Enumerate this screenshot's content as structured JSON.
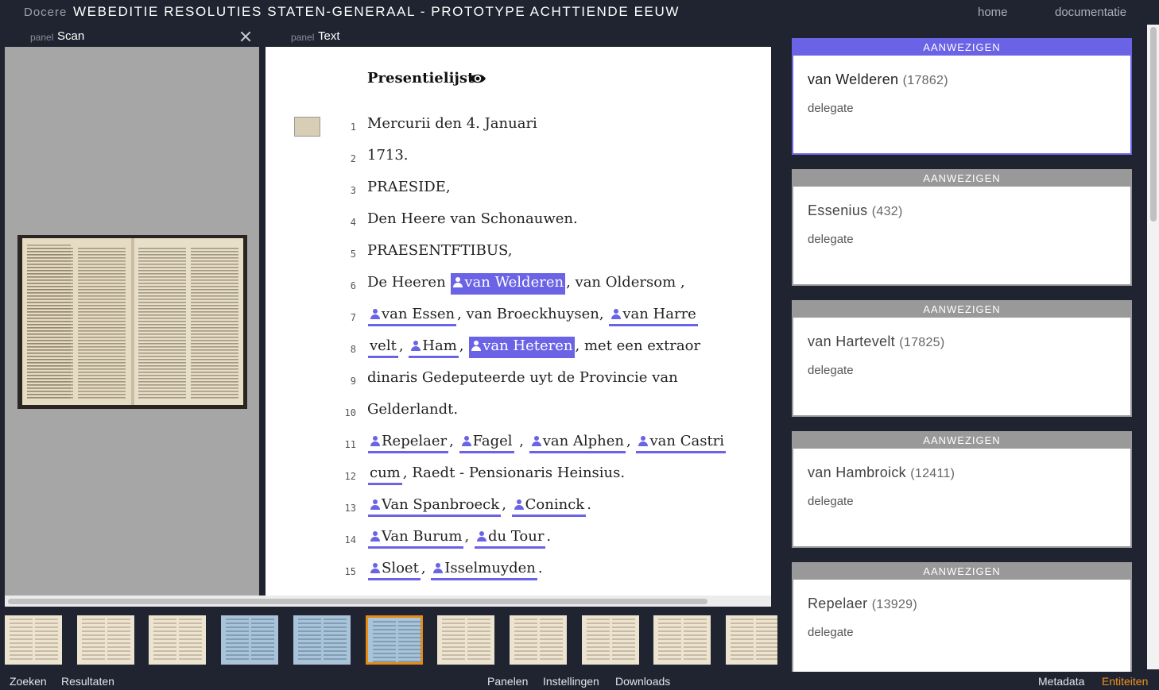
{
  "header": {
    "brand": "Docere",
    "title": "WEBEDITIE RESOLUTIES STATEN-GENERAAL - PROTOTYPE ACHTTIENDE EEUW",
    "nav": [
      "home",
      "documentatie"
    ]
  },
  "scan_panel": {
    "prefix": "panel",
    "name": "Scan"
  },
  "text_panel": {
    "prefix": "panel",
    "name": "Text",
    "section_title": "Presentielijst",
    "lines": [
      {
        "n": "1",
        "parts": [
          {
            "t": "Mercurii den 4. Januari"
          }
        ]
      },
      {
        "n": "2",
        "parts": [
          {
            "t": "1713."
          }
        ]
      },
      {
        "n": "3",
        "parts": [
          {
            "t": "PRAESIDE,"
          }
        ]
      },
      {
        "n": "4",
        "parts": [
          {
            "t": "Den Heere van Schonauwen."
          }
        ]
      },
      {
        "n": "5",
        "parts": [
          {
            "t": "PRAESENTFTIBUS,"
          }
        ]
      },
      {
        "n": "6",
        "parts": [
          {
            "t": "De Heeren "
          },
          {
            "e": "van Welderen",
            "sel": true
          },
          {
            "t": ", van Oldersom ,"
          }
        ]
      },
      {
        "n": "7",
        "parts": [
          {
            "e": "van Essen"
          },
          {
            "t": ", van Broeckhuysen, "
          },
          {
            "e": "van Harre"
          }
        ]
      },
      {
        "n": "8",
        "parts": [
          {
            "e": "velt",
            "noicon": true
          },
          {
            "t": ", "
          },
          {
            "e": "Ham"
          },
          {
            "t": ", "
          },
          {
            "e": "van Heteren",
            "sel": true
          },
          {
            "t": ", met een extraor"
          }
        ]
      },
      {
        "n": "9",
        "parts": [
          {
            "t": "dinaris Gedeputeerde uyt de Provincie van"
          }
        ]
      },
      {
        "n": "10",
        "parts": [
          {
            "t": "Gelderlandt."
          }
        ]
      },
      {
        "n": "11",
        "parts": [
          {
            "e": "Repelaer"
          },
          {
            "t": ", "
          },
          {
            "e": "Fagel"
          },
          {
            "t": " , "
          },
          {
            "e": "van Alphen"
          },
          {
            "t": ", "
          },
          {
            "e": "van Castri"
          }
        ]
      },
      {
        "n": "12",
        "parts": [
          {
            "e": "cum",
            "noicon": true
          },
          {
            "t": ", Raedt - Pensionaris Heinsius."
          }
        ]
      },
      {
        "n": "13",
        "parts": [
          {
            "e": "Van Spanbroeck"
          },
          {
            "t": ", "
          },
          {
            "e": "Coninck"
          },
          {
            "t": "."
          }
        ]
      },
      {
        "n": "14",
        "parts": [
          {
            "e": "Van Burum"
          },
          {
            "t": ", "
          },
          {
            "e": "du Tour"
          },
          {
            "t": "."
          }
        ]
      },
      {
        "n": "15",
        "parts": [
          {
            "e": "Sloet"
          },
          {
            "t": ", "
          },
          {
            "e": "Isselmuyden"
          },
          {
            "t": "."
          }
        ]
      }
    ]
  },
  "thumbnails": [
    {
      "color": "paper"
    },
    {
      "color": "paper"
    },
    {
      "color": "paper"
    },
    {
      "color": "blue"
    },
    {
      "color": "blue"
    },
    {
      "color": "blue",
      "active": true
    },
    {
      "color": "paper"
    },
    {
      "color": "paper"
    },
    {
      "color": "paper"
    },
    {
      "color": "paper"
    },
    {
      "color": "paper"
    }
  ],
  "entities": [
    {
      "tag": "AANWEZIGEN",
      "name": "van Welderen",
      "id": "(17862)",
      "role": "delegate",
      "active": true
    },
    {
      "tag": "AANWEZIGEN",
      "name": "Essenius",
      "id": "(432)",
      "role": "delegate"
    },
    {
      "tag": "AANWEZIGEN",
      "name": "van Hartevelt",
      "id": "(17825)",
      "role": "delegate"
    },
    {
      "tag": "AANWEZIGEN",
      "name": "van Hambroick",
      "id": "(12411)",
      "role": "delegate"
    },
    {
      "tag": "AANWEZIGEN",
      "name": "Repelaer",
      "id": "(13929)",
      "role": "delegate"
    }
  ],
  "bottom": {
    "left": [
      "Zoeken",
      "Resultaten"
    ],
    "center": [
      "Panelen",
      "Instellingen",
      "Downloads"
    ],
    "right": [
      "Metadata",
      "Entiteiten"
    ],
    "active": "Entiteiten"
  },
  "colors": {
    "entity": "#6b63e6",
    "active_tab": "#f0941e",
    "bg": "#1f2430"
  }
}
